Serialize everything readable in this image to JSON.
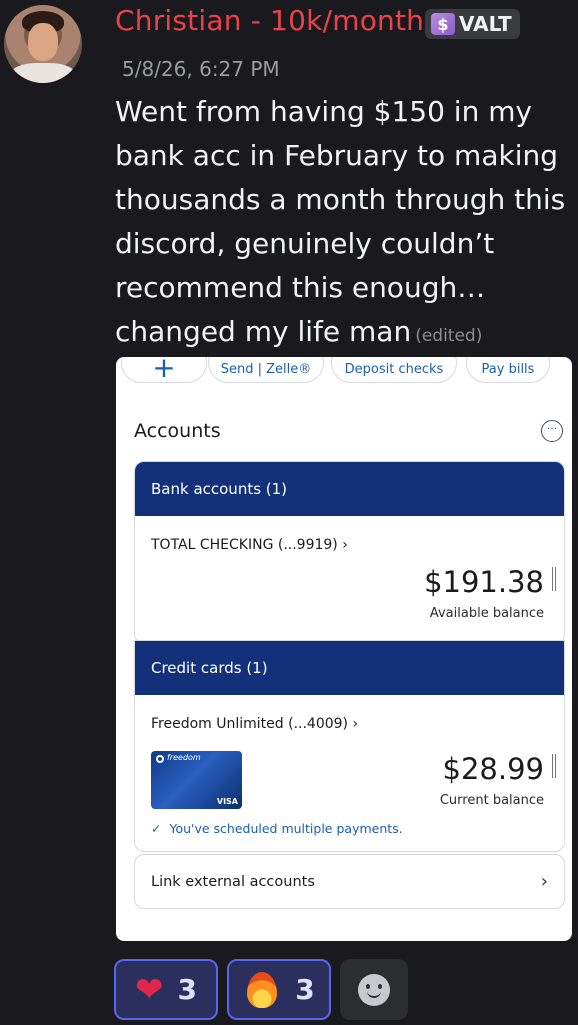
{
  "author": {
    "name": "Christian - 10k/month",
    "tag_label": "VALT",
    "tag_icon": "role-tag-icon",
    "name_color": "#e8434a"
  },
  "timestamp": "5/8/26, 6:27 PM",
  "message": {
    "lines": [
      "Went from having $150 in my",
      "bank acc in February to making",
      "thousands a month through this",
      "discord, genuinely couldn’t",
      "recommend this enough…",
      "changed my life man"
    ],
    "edited_label": "(edited)"
  },
  "attachment": {
    "quick_actions": {
      "plus": "+",
      "send": "Send | Zelle®",
      "deposit": "Deposit checks",
      "bills": "Pay bills"
    },
    "accounts_title": "Accounts",
    "bank_section": {
      "header": "Bank accounts (1)",
      "account_name": "TOTAL CHECKING (...9919) ›",
      "balance": "$191.38",
      "balance_label": "Available balance"
    },
    "credit_section": {
      "header": "Credit cards (1)",
      "account_name": "Freedom Unlimited (...4009) ›",
      "balance": "$28.99",
      "balance_label": "Current balance",
      "card_brand": "freedom",
      "card_network": "VISA",
      "scheduled_note": "You've scheduled multiple payments."
    },
    "link_external": "Link external accounts",
    "header_color": "#13317a",
    "link_color": "#1a5fb4"
  },
  "reactions": [
    {
      "emoji_name": "heart-icon",
      "emoji": "❤",
      "count": "3"
    },
    {
      "emoji_name": "fire-icon",
      "count": "3"
    }
  ],
  "add_reaction_icon": "smiley-icon"
}
